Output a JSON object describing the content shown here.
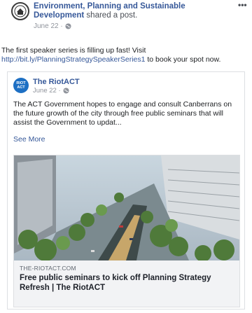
{
  "post": {
    "author": "Environment, Planning and Sustainable Development",
    "shared_text": "shared a post.",
    "date": "June 22 ·",
    "more_label": "•••",
    "body_text": "The first speaker series is filling up fast! Visit ",
    "link_text": "http://bit.ly/PlanningStrategySpeakerSeries1",
    "body_suffix": " to book your spot now.",
    "globe_icon": "globe-icon"
  },
  "shared": {
    "page_name": "The RiotACT",
    "avatar_text": "RIOT ACT",
    "date": "June 22 ·",
    "text": "The ACT Government hopes to engage and consult Canberrans on the future growth of the city through free public seminars that will assist the Government to updat...",
    "see_more": "See More"
  },
  "preview": {
    "domain": "THE-RIOTACT.COM",
    "title": "Free public seminars to kick off Planning Strategy Refresh | The RiotACT"
  }
}
